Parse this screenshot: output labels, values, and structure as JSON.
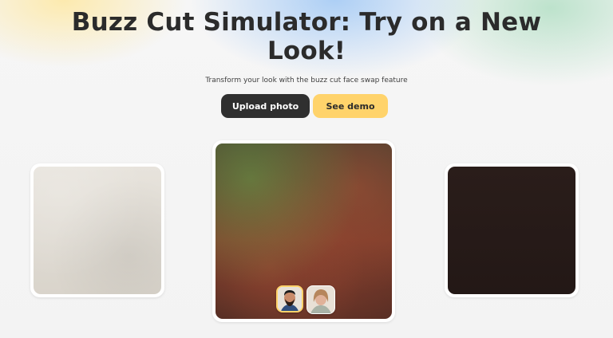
{
  "header": {
    "title": "Buzz Cut Simulator: Try on a New Look!",
    "subtitle": "Transform your look with the buzz cut face swap feature"
  },
  "actions": {
    "upload_label": "Upload photo",
    "demo_label": "See demo"
  },
  "gallery": {
    "items": [
      {
        "name": "left-example"
      },
      {
        "name": "center-example"
      },
      {
        "name": "right-example"
      }
    ],
    "face_thumbs": [
      {
        "selected": true
      },
      {
        "selected": false
      }
    ]
  },
  "colors": {
    "title": "#2b2b2b",
    "primary_button_bg": "#2f2f2f",
    "secondary_button_bg": "#ffd36b",
    "page_bg": "#f3f3f3"
  }
}
